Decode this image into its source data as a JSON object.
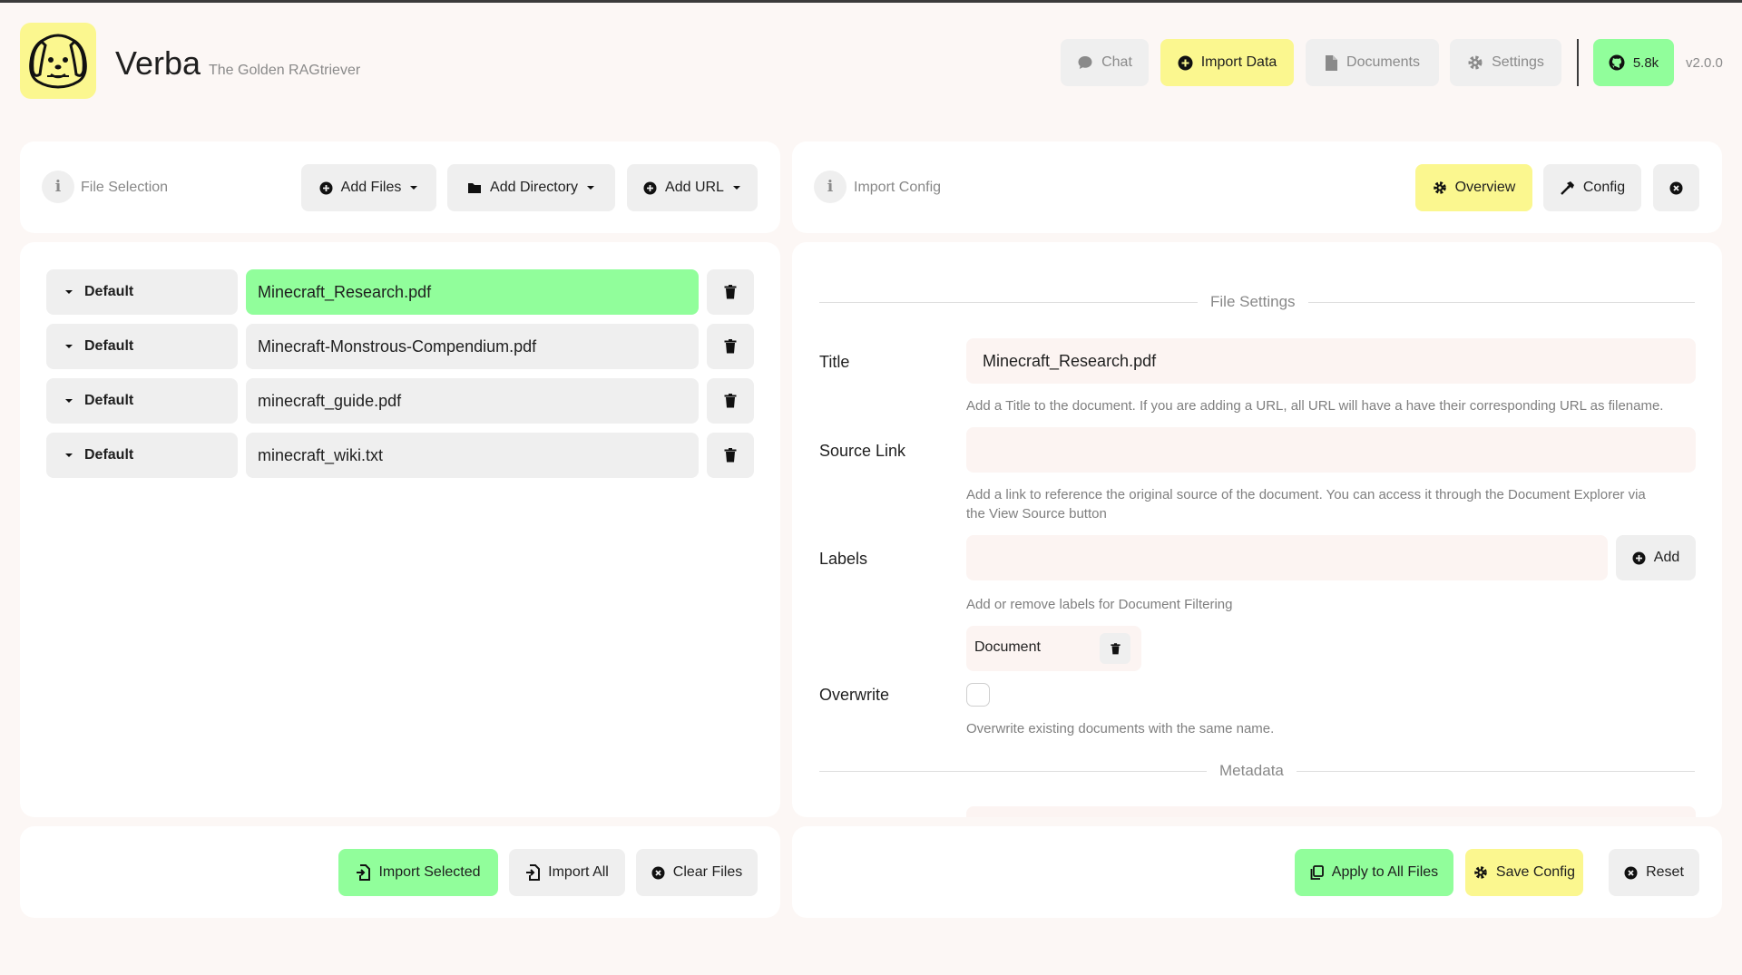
{
  "header": {
    "app_name": "Verba",
    "tagline": "The Golden RAGtriever",
    "nav": {
      "chat": "Chat",
      "import_data": "Import Data",
      "documents": "Documents",
      "settings": "Settings"
    },
    "github_stars": "5.8k",
    "version": "v2.0.0"
  },
  "file_selection": {
    "title": "File Selection",
    "add_files": "Add Files",
    "add_directory": "Add Directory",
    "add_url": "Add URL",
    "files": [
      {
        "config": "Default",
        "name": "Minecraft_Research.pdf",
        "selected": true
      },
      {
        "config": "Default",
        "name": "Minecraft-Monstrous-Compendium.pdf",
        "selected": false
      },
      {
        "config": "Default",
        "name": "minecraft_guide.pdf",
        "selected": false
      },
      {
        "config": "Default",
        "name": "minecraft_wiki.txt",
        "selected": false
      }
    ],
    "import_selected": "Import Selected",
    "import_all": "Import All",
    "clear_files": "Clear Files"
  },
  "import_config": {
    "title": "Import Config",
    "overview": "Overview",
    "config": "Config",
    "section_file_settings": "File Settings",
    "title_label": "Title",
    "title_value": "Minecraft_Research.pdf",
    "title_help": "Add a Title to the document. If you are adding a URL, all URL will have a have their corresponding URL as filename.",
    "source_link_label": "Source Link",
    "source_link_value": "",
    "source_link_help_1": "Add a link to reference the original source of the document. You can access it through the Document Explorer via",
    "source_link_help_2": "the View Source button",
    "labels_label": "Labels",
    "labels_value": "",
    "labels_add": "Add",
    "labels_help": "Add or remove labels for Document Filtering",
    "label_chip": "Document",
    "overwrite_label": "Overwrite",
    "overwrite_help": "Overwrite existing documents with the same name.",
    "overwrite_checked": false,
    "section_metadata": "Metadata",
    "apply_all": "Apply to All Files",
    "save_config": "Save Config",
    "reset": "Reset"
  },
  "colors": {
    "accent_yellow": "#fbf78f",
    "accent_green": "#91fe9b",
    "background": "#fcf7f5",
    "button_gray": "#efefef"
  }
}
